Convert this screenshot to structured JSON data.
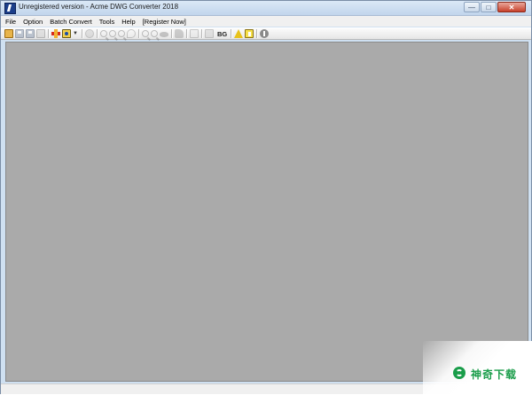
{
  "window": {
    "title": "Unregistered version - Acme DWG Converter 2018",
    "caption_buttons": [
      "—",
      "□",
      "✕"
    ]
  },
  "menubar": {
    "items": [
      "File",
      "Option",
      "Batch Convert",
      "Tools",
      "Help",
      "[Register Now]"
    ]
  },
  "toolbar": {
    "background_text_button": "BG"
  },
  "watermark": {
    "text": "神奇下载"
  },
  "colors": {
    "canvas": "#aaaaaa",
    "menubar": "#f0f0f0",
    "watermark_green": "#1a9d4a"
  }
}
